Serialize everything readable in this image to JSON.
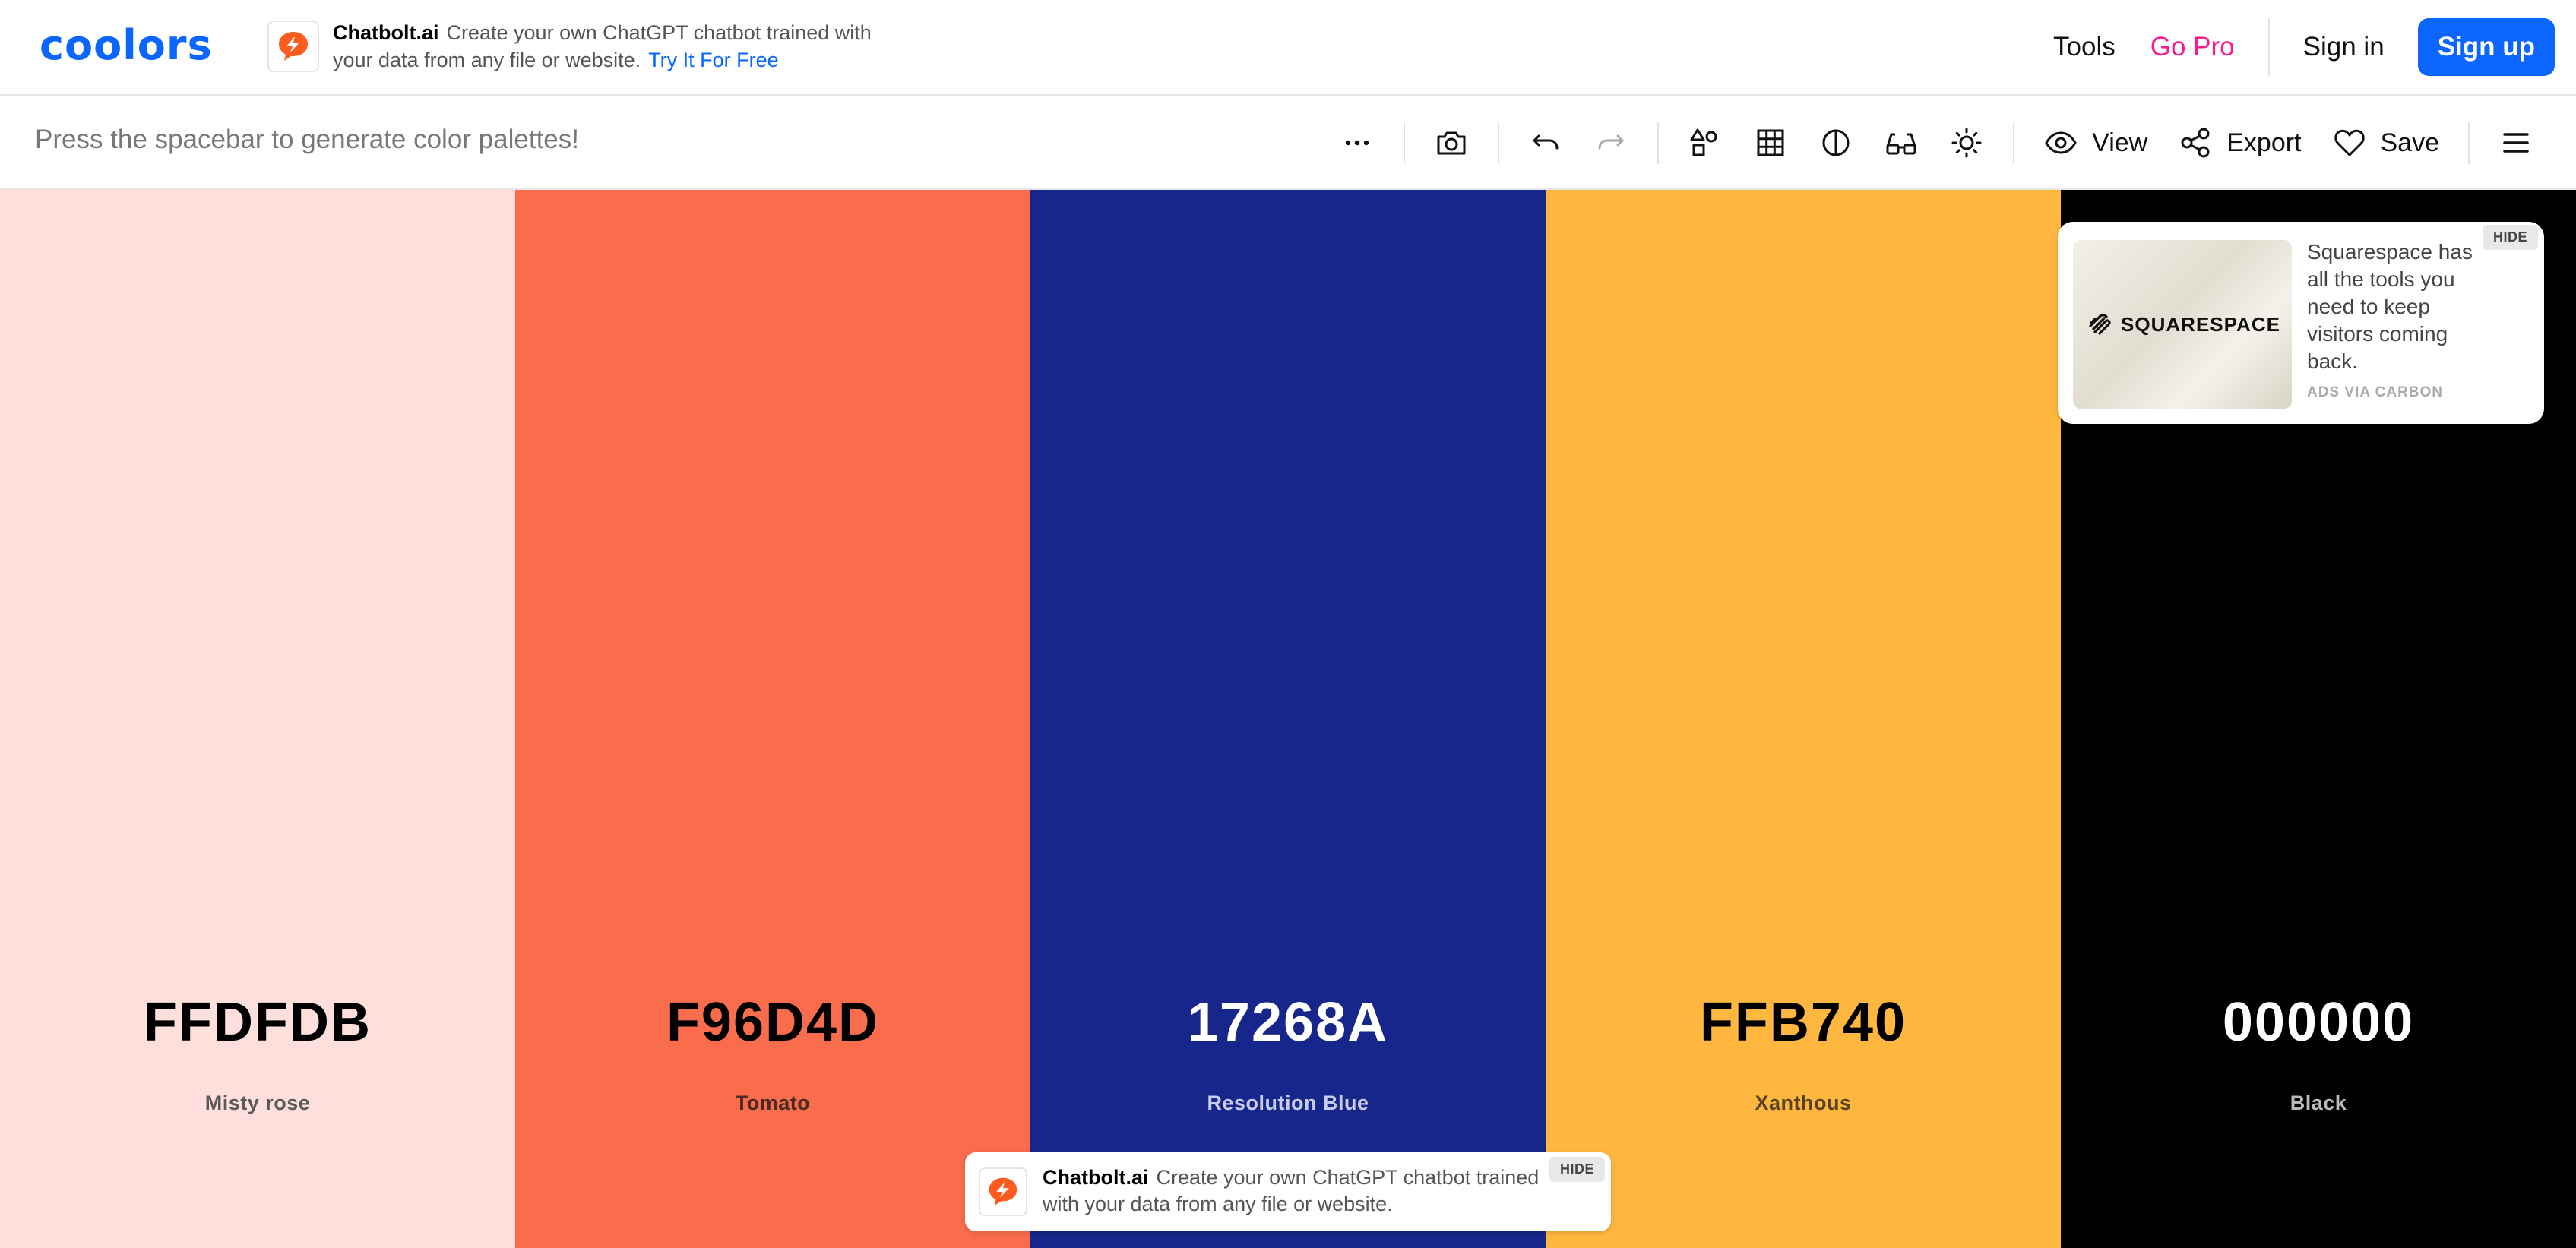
{
  "header": {
    "logo": "coolors",
    "ad": {
      "brand": "Chatbolt.ai",
      "text": "Create your own ChatGPT chatbot trained with your data from any file or website.",
      "link": "Try It For Free"
    },
    "nav": {
      "tools": "Tools",
      "go_pro": "Go Pro",
      "sign_in": "Sign in",
      "sign_up": "Sign up"
    }
  },
  "toolbar": {
    "hint": "Press the spacebar to generate color palettes!",
    "view_label": "View",
    "export_label": "Export",
    "save_label": "Save",
    "icons": [
      "more-icon",
      "camera-icon",
      "undo-icon",
      "redo-icon",
      "shapes-icon",
      "grid-icon",
      "contrast-icon",
      "glasses-icon",
      "brightness-icon",
      "eye-icon",
      "share-icon",
      "heart-icon",
      "menu-icon"
    ]
  },
  "palette": [
    {
      "hex": "FFDFDB",
      "name": "Misty rose",
      "color": "#FFDFDB",
      "text_color": "#000000",
      "name_color": "#5a5a5a"
    },
    {
      "hex": "F96D4D",
      "name": "Tomato",
      "color": "#F96D4D",
      "text_color": "#000000",
      "name_color": "#4a2a22"
    },
    {
      "hex": "17268A",
      "name": "Resolution Blue",
      "color": "#17268A",
      "text_color": "#FFFFFF",
      "name_color": "#c8ccea"
    },
    {
      "hex": "FFB740",
      "name": "Xanthous",
      "color": "#FFB740",
      "text_color": "#000000",
      "name_color": "#5a4320"
    },
    {
      "hex": "000000",
      "name": "Black",
      "color": "#000000",
      "text_color": "#FFFFFF",
      "name_color": "#bbbbbb"
    }
  ],
  "carbon_ad": {
    "text": "Squarespace has all the tools you need to keep visitors coming back.",
    "via": "ADS VIA CARBON",
    "hide": "HIDE",
    "image_logo": "SQUARESPACE"
  },
  "bottom_ad": {
    "brand": "Chatbolt.ai",
    "text": "Create your own ChatGPT chatbot trained with your data from any file or website.",
    "hide": "HIDE"
  },
  "colors": {
    "accent": "#0a66ff",
    "pro": "#ff1a8c",
    "chatbolt": "#ff5a1f"
  }
}
